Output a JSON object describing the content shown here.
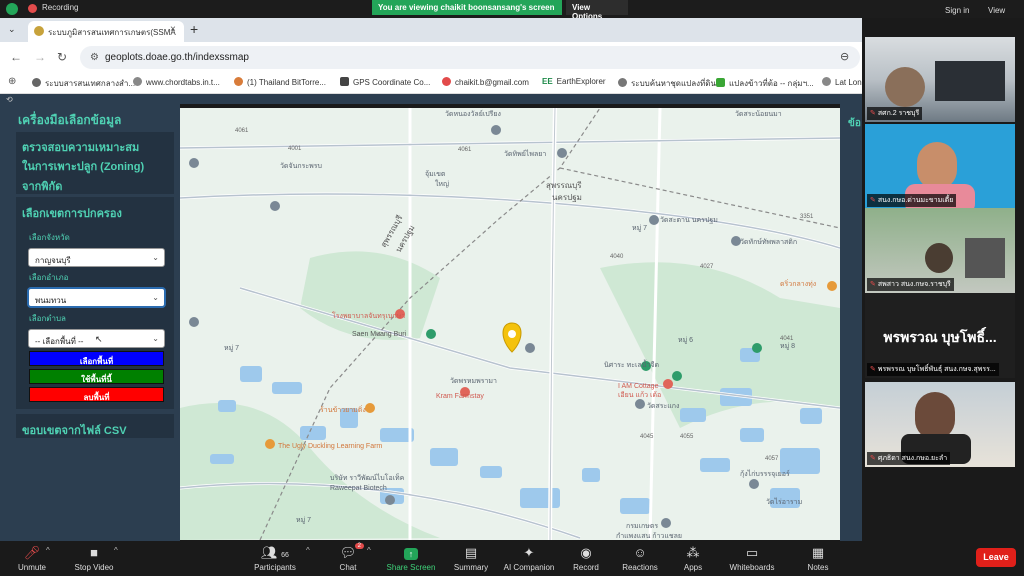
{
  "zoom_top": {
    "recording_label": "Recording",
    "viewing_banner": "You are viewing chaikit boonsansang's screen",
    "view_options": "View Options",
    "sign_in": "Sign in",
    "view": "View"
  },
  "browser": {
    "tab_title": "ระบบภูมิสารสนเทศการเกษตร(SSMA",
    "url": "geoplots.doae.go.th/indexssmap",
    "bookmarks": [
      "ระบบสารสนเทศกลางสำ...",
      "www.chordtabs.in.t...",
      "(1) Thailand BitTorre...",
      "GPS Coordinate Co...",
      "chaikit.b@gmail.com",
      "EarthExplorer",
      "ระบบค้นหาชุดแปลงที่ดิน",
      "แปลงข้าวที่ต้อ -- กลุ่มฯ...",
      "Lat Long"
    ]
  },
  "sidebar": {
    "title": "เครื่องมือเลือกข้อมูล",
    "zoning_check": [
      "ตรวจสอบความเหมาะสม",
      "ในการเพาะปลูก (Zoning)",
      "จากพิกัด"
    ],
    "admin_select": "เลือกเขตการปกครอง",
    "province_label": "เลือกจังหวัด",
    "province_value": "กาญจนบุรี",
    "district_label": "เลือกอำเภอ",
    "district_value": "พนมทวน",
    "subdistrict_label": "เลือกตำบล",
    "subdistrict_value": "-- เลือกพื้นที่ --",
    "btn_select_area": "เลือกพื้นที่",
    "btn_use_area": "ใช้พื้นที่นี้",
    "btn_delete_area": "ลบพื้นที่",
    "csv_boundary": "ขอบเขตจากไฟล์ CSV"
  },
  "right_strip": {
    "label": "ข้อ"
  },
  "map": {
    "labels": [
      "วัดหนองวัลย์เปรียง",
      "วัดสระน้อยนมา",
      "วัดทิพย์ไพลยา",
      "จุ้มเขต",
      "ใหญ่",
      "วัดจันกระพรบ",
      "สุพรรณบุรี",
      "นครปฐม",
      "วัดสะตาน นครปฐม",
      "วัดทักษ์ทัพพลาสติก",
      "ดริ่วกลางทุ่ง",
      "สุพรรณบุรี",
      "นครปฐม",
      "โรงพยาบาลจันทรุเบกษา",
      "Saen Muang Buri",
      "นิศาระ ทะเลน้ำจืด",
      "I AM Cottage",
      "เอียน แก้ว เด้อ",
      "วัดพรหมพรามา",
      "Kram Farmstay",
      "ร้านข้าวยามติ่ง",
      "วัดสระแกง",
      "The Ugly Duckling Learning Farm",
      "บริษัท ราวีพัฒน์ไบโอเท็ค",
      "Raweepat Biotech",
      "วัดสระเตารีง",
      "กรมเกษตร",
      "กำแพงแสน ก้าวแชลย",
      "กุ้งไก่บรรรจุเยอร์",
      "วัดไร่อาราม",
      "หมู่ 7",
      "หมู่ 6",
      "หมู่ 7",
      "หมู่ 8",
      "หมู่ 7",
      "4061",
      "4001",
      "4061",
      "3351",
      "4027",
      "4040",
      "4045",
      "4055",
      "4057",
      "4041",
      "3004"
    ]
  },
  "participants": [
    {
      "name": "สศก.2 ราชบุรี"
    },
    {
      "name": "สนง.กษอ.ด่านมะขามเตี้ย"
    },
    {
      "name": "สพสาว สนง.กษจ.ราชบุรี"
    },
    {
      "name": "พรพรรณ บุษโพธิ์พันธุ์ สนง.กษจ.สุพรร...",
      "display": "พรพรวณ บุษโพธิ์..."
    },
    {
      "name": "ศุภธิดา สนง.กษอ.ยะลำ"
    }
  ],
  "zoom_bar": {
    "unmute": "Unmute",
    "stop_video": "Stop Video",
    "participants": "Participants",
    "participants_count": "66",
    "chat": "Chat",
    "chat_badge": "2",
    "share_screen": "Share Screen",
    "summary": "Summary",
    "ai_companion": "AI Companion",
    "record": "Record",
    "reactions": "Reactions",
    "apps": "Apps",
    "whiteboards": "Whiteboards",
    "notes": "Notes",
    "leave": "Leave"
  }
}
